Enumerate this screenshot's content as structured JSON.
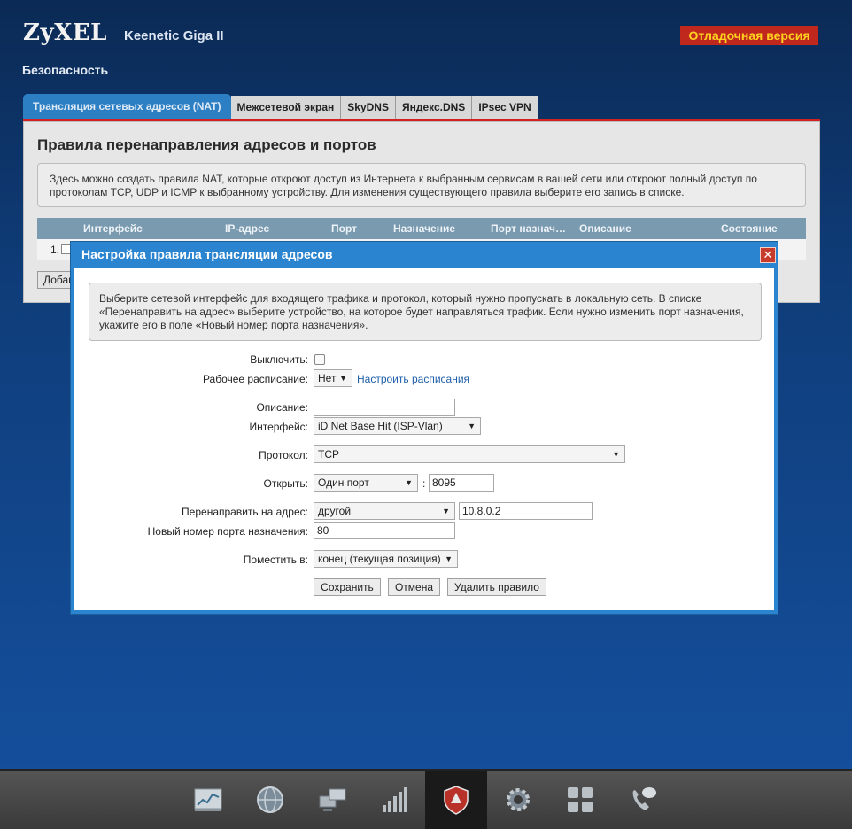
{
  "header": {
    "logo": "ZyXEL",
    "model": "Keenetic Giga II",
    "debug_badge": "Отладочная версия",
    "section": "Безопасность"
  },
  "tabs": [
    {
      "label": "Трансляция сетевых адресов (NAT)",
      "active": true
    },
    {
      "label": "Межсетевой экран",
      "active": false
    },
    {
      "label": "SkyDNS",
      "active": false
    },
    {
      "label": "Яндекс.DNS",
      "active": false
    },
    {
      "label": "IPsec VPN",
      "active": false
    }
  ],
  "panel": {
    "title": "Правила перенаправления адресов и портов",
    "info": "Здесь можно создать правила NAT, которые откроют доступ из Интернета к выбранным сервисам в вашей сети или откроют полный доступ по протоколам TCP, UDP и ICMP к выбранному устройству. Для изменения существующего правила выберите его запись в списке.",
    "table": {
      "columns": [
        "Интерфейс",
        "IP-адрес",
        "Порт",
        "Назначение",
        "Порт назнач…",
        "Описание",
        "Состояние"
      ],
      "row_number": "1.",
      "add_button": "Добавить"
    }
  },
  "modal": {
    "title": "Настройка правила трансляции адресов",
    "close": "✕",
    "info": "Выберите сетевой интерфейс для входящего трафика и протокол, который нужно пропускать в локальную сеть. В списке «Перенаправить на адрес» выберите устройство, на которое будет направляться трафик. Если нужно изменить порт назначения, укажите его в поле «Новый номер порта назначения».",
    "fields": {
      "disable_label": "Выключить:",
      "schedule_label": "Рабочее расписание:",
      "schedule_value": "Нет",
      "schedule_link": "Настроить расписания",
      "description_label": "Описание:",
      "description_value": "",
      "interface_label": "Интерфейс:",
      "interface_value": "iD Net Base Hit (ISP-Vlan)",
      "protocol_label": "Протокол:",
      "protocol_value": "TCP",
      "open_label": "Открыть:",
      "open_value": "Один порт",
      "open_port": "8095",
      "redirect_label": "Перенаправить на адрес:",
      "redirect_value": "другой",
      "redirect_ip": "10.8.0.2",
      "new_port_label": "Новый номер порта назначения:",
      "new_port_value": "80",
      "place_label": "Поместить в:",
      "place_value": "конец (текущая позиция)"
    },
    "buttons": {
      "save": "Сохранить",
      "cancel": "Отмена",
      "delete": "Удалить правило"
    }
  },
  "bottom_nav": [
    {
      "icon": "chart-icon"
    },
    {
      "icon": "globe-icon"
    },
    {
      "icon": "network-icon"
    },
    {
      "icon": "signal-icon"
    },
    {
      "icon": "shield-icon",
      "active": true
    },
    {
      "icon": "gear-icon"
    },
    {
      "icon": "apps-icon"
    },
    {
      "icon": "phone-icon"
    }
  ],
  "colors": {
    "accent": "#2b84cf",
    "debug_bg": "#c0281e",
    "debug_text": "#ffd21f",
    "tab_underline": "#d32020"
  }
}
